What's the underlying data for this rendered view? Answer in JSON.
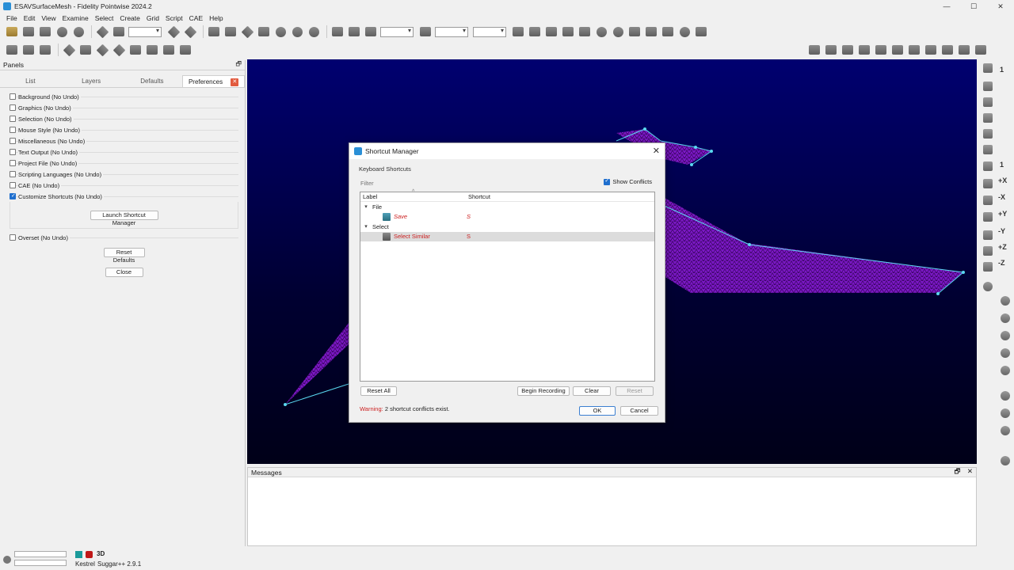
{
  "window": {
    "title": "ESAVSurfaceMesh - Fidelity Pointwise 2024.2",
    "minimize": "—",
    "maximize": "☐",
    "close": "✕"
  },
  "menu": [
    "File",
    "Edit",
    "View",
    "Examine",
    "Select",
    "Create",
    "Grid",
    "Script",
    "CAE",
    "Help"
  ],
  "panels": {
    "title": "Panels",
    "undock": "🗗",
    "tabs": [
      "List",
      "Layers",
      "Defaults",
      "Preferences"
    ],
    "active_tab": "Preferences",
    "preferences": [
      {
        "label": "Background (No Undo)",
        "checked": false
      },
      {
        "label": "Graphics (No Undo)",
        "checked": false
      },
      {
        "label": "Selection (No Undo)",
        "checked": false
      },
      {
        "label": "Mouse Style (No Undo)",
        "checked": false
      },
      {
        "label": "Miscellaneous (No Undo)",
        "checked": false
      },
      {
        "label": "Text Output (No Undo)",
        "checked": false
      },
      {
        "label": "Project File (No Undo)",
        "checked": false
      },
      {
        "label": "Scripting Languages (No Undo)",
        "checked": false
      },
      {
        "label": "CAE (No Undo)",
        "checked": false
      },
      {
        "label": "Customize Shortcuts (No Undo)",
        "checked": true
      }
    ],
    "launch_button": "Launch Shortcut Manager",
    "overset": {
      "label": "Overset (No Undo)",
      "checked": false
    },
    "reset_button": "Reset Defaults",
    "close_button": "Close"
  },
  "messages": {
    "title": "Messages",
    "undock": "🗗",
    "close": "✕"
  },
  "status": {
    "mode": "3D",
    "solver": "Kestrel",
    "version": "Suggar++ 2.9.1"
  },
  "dialog": {
    "title": "Shortcut Manager",
    "close": "✕",
    "group": "Keyboard Shortcuts",
    "filter_placeholder": "Filter",
    "show_conflicts": "Show Conflicts",
    "columns": {
      "label": "Label",
      "shortcut": "Shortcut",
      "sort_caret": "^"
    },
    "tree": [
      {
        "category": "File",
        "items": [
          {
            "label": "Save",
            "shortcut": "S",
            "selected": false
          }
        ]
      },
      {
        "category": "Select",
        "items": [
          {
            "label": "Select Similar",
            "shortcut": "S",
            "selected": true
          }
        ]
      }
    ],
    "buttons": {
      "reset_all": "Reset All",
      "begin_recording": "Begin Recording",
      "clear": "Clear",
      "reset": "Reset",
      "ok": "OK",
      "cancel": "Cancel"
    },
    "warning_prefix": "Warning:",
    "warning_text": "2 shortcut conflicts exist."
  },
  "icons": {
    "twisty": "▾",
    "right_bar_labels": [
      "1",
      "1",
      "+X",
      "-X",
      "+Y",
      "-Y",
      "+Z",
      "-Z"
    ]
  },
  "colors": {
    "viewport_bg": "#000050",
    "mesh": "#8a1ad0",
    "conflict": "#cc2020",
    "accent": "#1f6fce"
  }
}
